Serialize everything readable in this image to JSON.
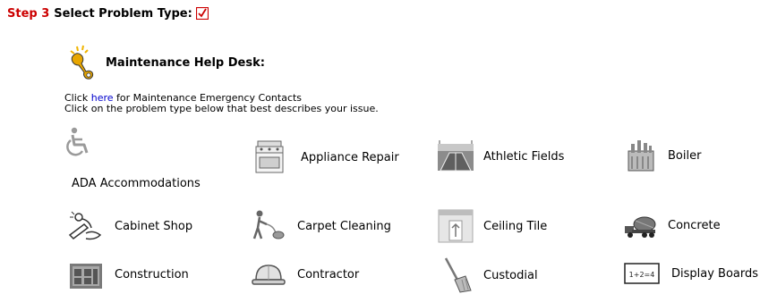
{
  "step": {
    "number": "Step 3",
    "title": "Select Problem Type:"
  },
  "desk": {
    "title": "Maintenance Help Desk:"
  },
  "intro": {
    "line1_pre": "Click ",
    "link": "here",
    "line1_post": " for Maintenance Emergency Contacts",
    "line2": "Click on the problem type below that best describes your issue."
  },
  "problem_types": {
    "ada": "ADA Accommodations",
    "appliance": "Appliance Repair",
    "athletic": "Athletic Fields",
    "boiler": "Boiler",
    "cabinet": "Cabinet Shop",
    "carpet": "Carpet Cleaning",
    "ceiling": "Ceiling Tile",
    "concrete": "Concrete",
    "construction": "Construction",
    "contractor": "Contractor",
    "custodial": "Custodial",
    "display": "Display Boards",
    "display_icon_text": "1+2=4"
  },
  "colors": {
    "step_number": "#cc0000",
    "checkbox": "#cc0000",
    "link": "#0000cc"
  }
}
